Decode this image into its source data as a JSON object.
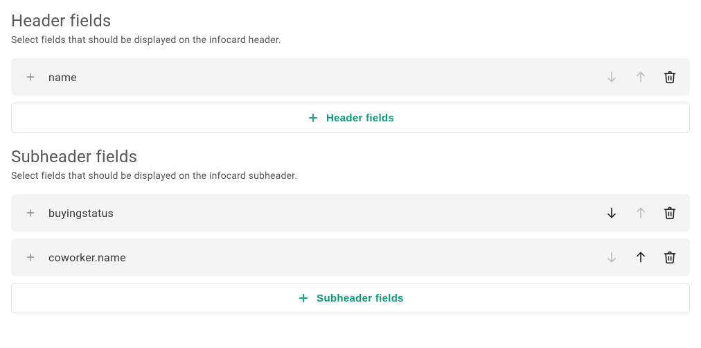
{
  "accent_color": "#0d9475",
  "sections": [
    {
      "title": "Header fields",
      "description": "Select fields that should be displayed on the infocard header.",
      "add_label": "Header fields",
      "items": [
        {
          "label": "name",
          "down_enabled": false,
          "up_enabled": false
        }
      ]
    },
    {
      "title": "Subheader fields",
      "description": "Select fields that should be displayed on the infocard subheader.",
      "add_label": "Subheader fields",
      "items": [
        {
          "label": "buyingstatus",
          "down_enabled": true,
          "up_enabled": false
        },
        {
          "label": "coworker.name",
          "down_enabled": false,
          "up_enabled": true
        }
      ]
    }
  ]
}
